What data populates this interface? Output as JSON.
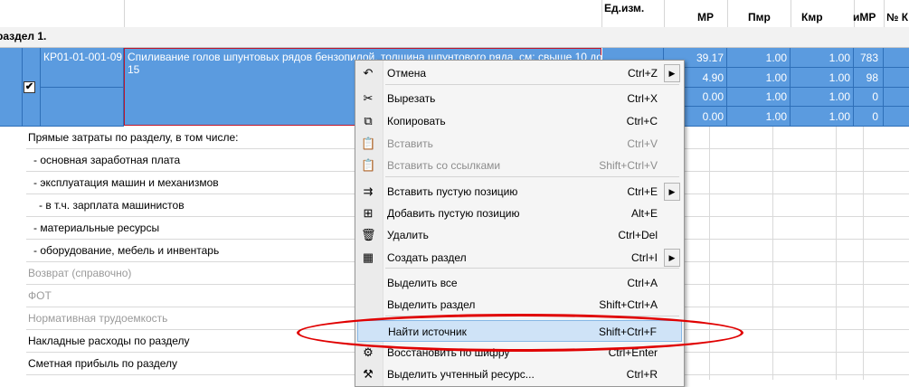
{
  "header": {
    "unit_label": "Ед.изм.",
    "columns": [
      "МР",
      "Пмр",
      "Кмр",
      "иМР",
      "№ К"
    ]
  },
  "section_title": "раздел 1.",
  "position": {
    "code": "КР01-01-001-09",
    "description": "Спиливание голов шпунтовых рядов бензопилой, толщина шпунтового ряда, см: свыше 10 до 15",
    "rows": [
      [
        "39.17",
        "1.00",
        "1.00",
        "783"
      ],
      [
        "4.90",
        "1.00",
        "1.00",
        "98"
      ],
      [
        "0.00",
        "1.00",
        "1.00",
        "0"
      ],
      [
        "0.00",
        "1.00",
        "1.00",
        "0"
      ]
    ]
  },
  "summary_rows": [
    {
      "label": "Прямые затраты по разделу, в том числе:",
      "muted": false
    },
    {
      "label": "- основная заработная плата",
      "muted": false
    },
    {
      "label": "- эксплуатация машин и механизмов",
      "muted": false
    },
    {
      "label": "- в т.ч. зарплата машинистов",
      "muted": false
    },
    {
      "label": "- материальные ресурсы",
      "muted": false
    },
    {
      "label": "- оборудование, мебель и инвентарь",
      "muted": false
    },
    {
      "label": "Возврат (справочно)",
      "muted": true
    },
    {
      "label": "ФОТ",
      "muted": true
    },
    {
      "label": "Нормативная трудоемкость",
      "muted": true
    },
    {
      "label": "Накладные расходы по разделу",
      "muted": false
    },
    {
      "label": "Сметная прибыль по разделу",
      "muted": false
    }
  ],
  "context_menu": {
    "items": [
      {
        "label": "Отмена",
        "shortcut": "Ctrl+Z",
        "icon": "undo-icon",
        "glyph": "↶",
        "disabled": false,
        "submenu": true
      },
      {
        "label": "Вырезать",
        "shortcut": "Ctrl+X",
        "icon": "scissors-icon",
        "glyph": "✂",
        "disabled": false,
        "submenu": false
      },
      {
        "label": "Копировать",
        "shortcut": "Ctrl+C",
        "icon": "copy-icon",
        "glyph": "⧉",
        "disabled": false,
        "submenu": false
      },
      {
        "label": "Вставить",
        "shortcut": "Ctrl+V",
        "icon": "paste-icon",
        "glyph": "📋",
        "disabled": true,
        "submenu": false
      },
      {
        "label": "Вставить со ссылками",
        "shortcut": "Shift+Ctrl+V",
        "icon": "paste-link-icon",
        "glyph": "📋",
        "disabled": true,
        "submenu": false
      },
      {
        "label": "Вставить пустую позицию",
        "shortcut": "Ctrl+E",
        "icon": "insert-row-icon",
        "glyph": "⇉",
        "disabled": false,
        "submenu": true
      },
      {
        "label": "Добавить пустую позицию",
        "shortcut": "Alt+E",
        "icon": "add-row-icon",
        "glyph": "⊞",
        "disabled": false,
        "submenu": false
      },
      {
        "label": "Удалить",
        "shortcut": "Ctrl+Del",
        "icon": "trash-icon",
        "glyph": "🗑",
        "disabled": false,
        "submenu": false
      },
      {
        "label": "Создать раздел",
        "shortcut": "Ctrl+I",
        "icon": "section-icon",
        "glyph": "▦",
        "disabled": false,
        "submenu": true
      },
      {
        "label": "Выделить все",
        "shortcut": "Ctrl+A",
        "icon": "",
        "glyph": "",
        "disabled": false,
        "submenu": false
      },
      {
        "label": "Выделить раздел",
        "shortcut": "Shift+Ctrl+A",
        "icon": "",
        "glyph": "",
        "disabled": false,
        "submenu": false
      },
      {
        "label": "Найти источник",
        "shortcut": "Shift+Ctrl+F",
        "icon": "",
        "glyph": "",
        "disabled": false,
        "submenu": false,
        "highlighted": true
      },
      {
        "label": "Восстановить по шифру",
        "shortcut": "Ctrl+Enter",
        "icon": "restore-icon",
        "glyph": "⚙",
        "disabled": false,
        "submenu": false
      },
      {
        "label": "Выделить учтенный ресурс...",
        "shortcut": "Ctrl+R",
        "icon": "resource-icon",
        "glyph": "⚒",
        "disabled": false,
        "submenu": false
      }
    ]
  },
  "colors": {
    "selection": "#5b9bdf",
    "highlight_ellipse": "#e00000",
    "menu_highlight": "#cfe3f7"
  }
}
